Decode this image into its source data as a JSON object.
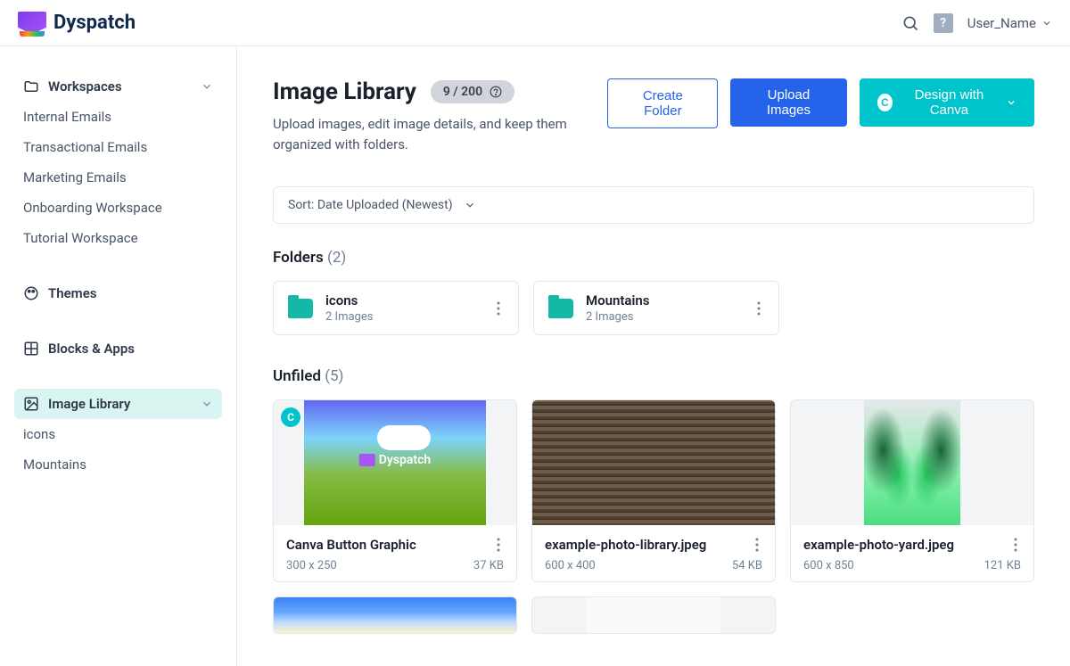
{
  "brand": "Dyspatch",
  "user": "User_Name",
  "sidebar": {
    "workspaces": {
      "label": "Workspaces",
      "items": [
        "Internal Emails",
        "Transactional Emails",
        "Marketing Emails",
        "Onboarding Workspace",
        "Tutorial Workspace"
      ]
    },
    "themes": "Themes",
    "blocks": "Blocks & Apps",
    "image_library": {
      "label": "Image Library",
      "items": [
        "icons",
        "Mountains"
      ]
    }
  },
  "page": {
    "title": "Image Library",
    "count": "9 / 200",
    "subtitle": "Upload images, edit image details, and keep them organized with folders."
  },
  "actions": {
    "create_folder": "Create Folder",
    "upload_images": "Upload Images",
    "design_canva": "Design with Canva"
  },
  "sort": {
    "label": "Sort: Date Uploaded (Newest)"
  },
  "folders": {
    "title": "Folders",
    "count": "(2)",
    "items": [
      {
        "name": "icons",
        "meta": "2 Images"
      },
      {
        "name": "Mountains",
        "meta": "2 Images"
      }
    ]
  },
  "unfiled": {
    "title": "Unfiled",
    "count": "(5)",
    "items": [
      {
        "name": "Canva Button Graphic",
        "dims": "300 x 250",
        "size": "37 KB",
        "canva": true
      },
      {
        "name": "example-photo-library.jpeg",
        "dims": "600 x 400",
        "size": "54 KB"
      },
      {
        "name": "example-photo-yard.jpeg",
        "dims": "600 x 850",
        "size": "121 KB"
      }
    ]
  },
  "thumb1_brand": "Dyspatch"
}
